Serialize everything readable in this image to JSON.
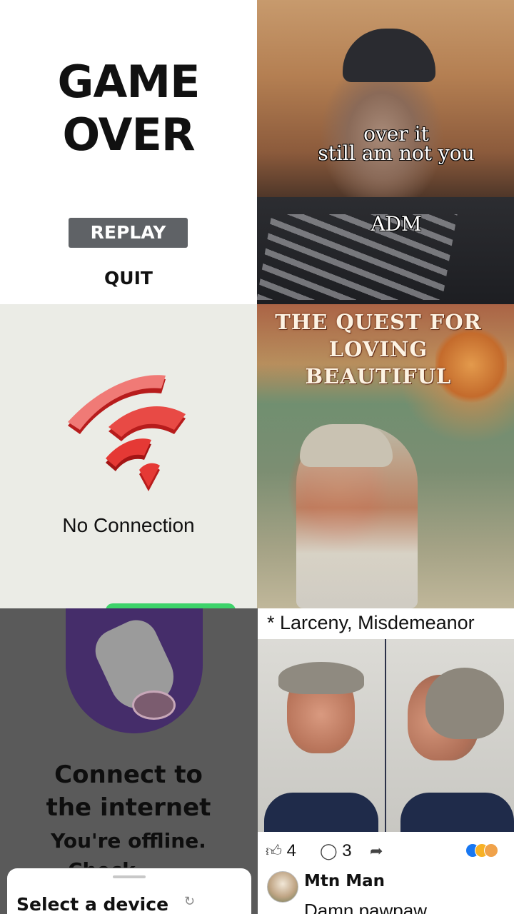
{
  "game_over": {
    "title_line1": "GAME",
    "title_line2": "OVER",
    "replay_label": "REPLAY",
    "quit_label": "QUIT"
  },
  "selfie": {
    "caption_line1": "over it",
    "caption_line2": "still am not you",
    "caption_line3": "ADM"
  },
  "no_connection": {
    "label": "No Connection",
    "icon": "wifi-broken-icon",
    "icon_color": "#e53935"
  },
  "book_cover": {
    "title_line1": "THE QUEST FOR",
    "title_line2": "LOVING",
    "title_line3": "BEAUTIFUL"
  },
  "offline": {
    "heading_line1": "Connect to",
    "heading_line2": "the internet",
    "subheading": "You're offline.",
    "subheading_peek": "Check your",
    "illustration": "astronaut-cow-illustration",
    "sheet": {
      "title": "Select a device",
      "refresh_icon": "refresh-icon"
    }
  },
  "post": {
    "charge": "* Larceny, Misdemeanor",
    "likes": "4",
    "comments": "3",
    "reactions": [
      "like-icon",
      "laugh-icon",
      "sad-icon"
    ],
    "comment_author": "Mtn Man",
    "comment_text": "Damn pawpaw"
  }
}
